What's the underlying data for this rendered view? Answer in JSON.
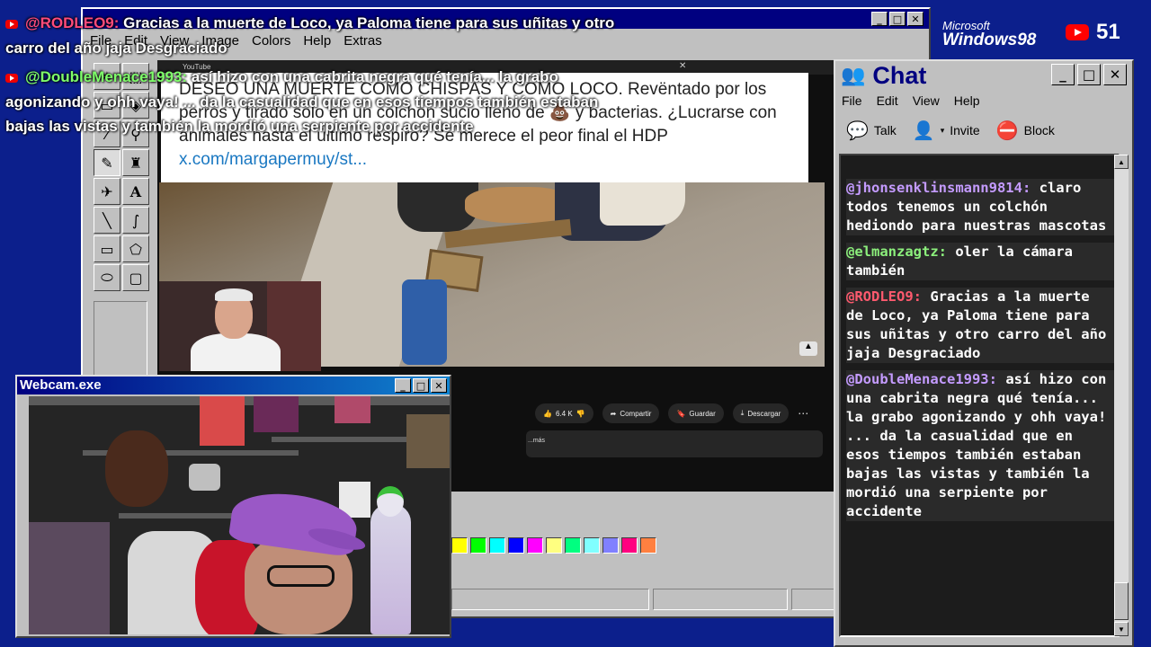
{
  "paint": {
    "menu": [
      "File",
      "Edit",
      "View",
      "Image",
      "Colors",
      "Help",
      "Extras"
    ],
    "palette": [
      "#ffff00",
      "#00ff00",
      "#00ffff",
      "#0000ff",
      "#ff00ff",
      "#ffff80",
      "#00ff80",
      "#80ffff",
      "#8080ff",
      "#ff0080",
      "#ff8040"
    ]
  },
  "overlay_chat": [
    {
      "user": "@RODLEO9:",
      "text": "Gracias a la muerte de Loco, ya Paloma tiene para sus uñitas y otro",
      "color": "red"
    },
    {
      "user": "",
      "text": "carro del año jaja Desgraciado",
      "color": ""
    },
    {
      "user": "@DoubleMenace1993:",
      "text": "así hizo con una cabrita negra qué tenía... la grabo",
      "color": "green"
    },
    {
      "user": "",
      "text": "agonizando y ohh vaya! ... da la casualidad que en esos tiempos también estaban",
      "color": ""
    },
    {
      "user": "",
      "text": "bajas las vistas y también la mordió una serpiente por accidente",
      "color": ""
    }
  ],
  "youtube": {
    "tab_title": "YouTube",
    "tweet_text": "DESEO UNA MUERTE COMO CHISPAS Y COMO LOCO. Revëntado por los perros y tirado solo en un colchón sucio lleno de 💩 y bacterias. ¿Lucrarse con animales hasta el último respiro? Se merece el peor final el HDP",
    "tweet_link": "x.com/margapermuy/st...",
    "likes": "6.4 K",
    "share": "Compartir",
    "save": "Guardar",
    "download": "Descargar",
    "desc_more": "...más"
  },
  "webcam": {
    "title": "Webcam.exe"
  },
  "chat": {
    "title": "Chat",
    "menu": [
      "File",
      "Edit",
      "View",
      "Help"
    ],
    "toolbar": {
      "talk": "Talk",
      "invite": "Invite",
      "block": "Block"
    },
    "messages": [
      {
        "user": "@jhonsenklinsmann9814:",
        "text": "claro todos tenemos un colchón hediondo para nuestras mascotas",
        "color": ""
      },
      {
        "user": "@elmanzagtz:",
        "text": "oler la cámara también",
        "color": "green"
      },
      {
        "user": "@RODLEO9:",
        "text": "Gracias a la muerte de Loco, ya Paloma tiene para sus uñitas y otro carro del año jaja Desgraciado",
        "color": "red"
      },
      {
        "user": "@DoubleMenace1993:",
        "text": "así hizo con una cabrita negra qué tenía... la grabo agonizando y ohh vaya! ... da la casualidad que en esos tiempos también estaban bajas las vistas y también la mordió una serpiente por accidente",
        "color": ""
      }
    ]
  },
  "branding": {
    "microsoft": "Microsoft",
    "windows": "Windows98"
  },
  "viewers": "51"
}
